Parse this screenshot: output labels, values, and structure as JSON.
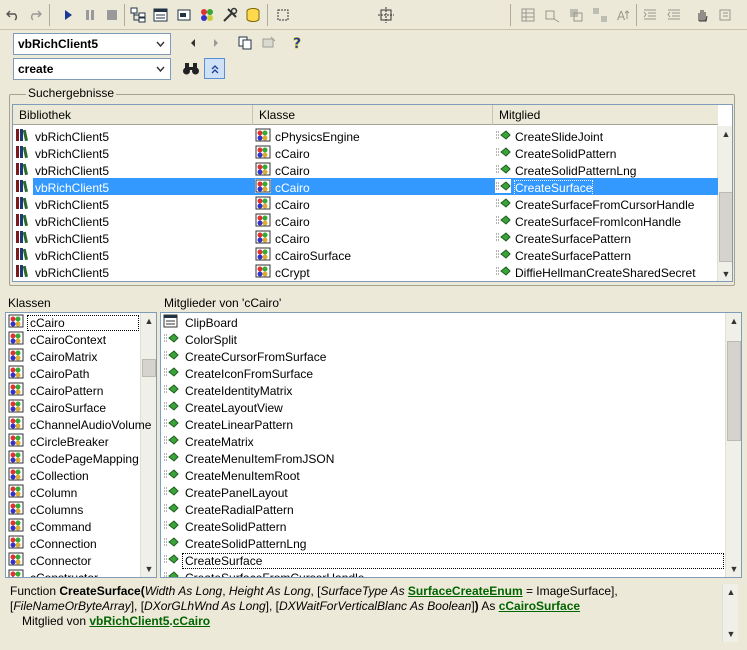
{
  "toolbar": {
    "buttons": [
      {
        "name": "undo-icon"
      },
      {
        "name": "redo-icon"
      },
      {
        "name": "run-icon"
      },
      {
        "name": "pause-icon"
      },
      {
        "name": "stop-icon"
      },
      {
        "name": "project-explorer-icon"
      },
      {
        "name": "properties-icon"
      },
      {
        "name": "form-layout-icon"
      },
      {
        "name": "object-browser-icon"
      },
      {
        "name": "toolbox-icon"
      },
      {
        "name": "database-icon"
      },
      {
        "name": "select-icon"
      },
      {
        "name": "align-icon"
      }
    ]
  },
  "library_combo": {
    "value": "vbRichClient5"
  },
  "search_combo": {
    "value": "create"
  },
  "search_results": {
    "title": "Suchergebnisse",
    "columns": [
      "Bibliothek",
      "Klasse",
      "Mitglied"
    ],
    "rows": [
      {
        "library": "vbRichClient5",
        "class": "cPhysicsEngine",
        "member": "CreateSlideJoint"
      },
      {
        "library": "vbRichClient5",
        "class": "cCairo",
        "member": "CreateSolidPattern"
      },
      {
        "library": "vbRichClient5",
        "class": "cCairo",
        "member": "CreateSolidPatternLng"
      },
      {
        "library": "vbRichClient5",
        "class": "cCairo",
        "member": "CreateSurface",
        "selected": true
      },
      {
        "library": "vbRichClient5",
        "class": "cCairo",
        "member": "CreateSurfaceFromCursorHandle"
      },
      {
        "library": "vbRichClient5",
        "class": "cCairo",
        "member": "CreateSurfaceFromIconHandle"
      },
      {
        "library": "vbRichClient5",
        "class": "cCairo",
        "member": "CreateSurfacePattern"
      },
      {
        "library": "vbRichClient5",
        "class": "cCairoSurface",
        "member": "CreateSurfacePattern"
      },
      {
        "library": "vbRichClient5",
        "class": "cCrypt",
        "member": "DiffieHellmanCreateSharedSecret"
      }
    ]
  },
  "classes_pane": {
    "title": "Klassen",
    "items": [
      "cCairo",
      "cCairoContext",
      "cCairoMatrix",
      "cCairoPath",
      "cCairoPattern",
      "cCairoSurface",
      "cChannelAudioVolume",
      "cCircleBreaker",
      "cCodePageMapping",
      "cCollection",
      "cColumn",
      "cColumns",
      "cCommand",
      "cConnection",
      "cConnector",
      "cConstructor"
    ]
  },
  "members_pane": {
    "title": "Mitglieder von 'cCairo'",
    "items": [
      "ClipBoard",
      "ColorSplit",
      "CreateCursorFromSurface",
      "CreateIconFromSurface",
      "CreateIdentityMatrix",
      "CreateLayoutView",
      "CreateLinearPattern",
      "CreateMatrix",
      "CreateMenuItemFromJSON",
      "CreateMenuItemRoot",
      "CreatePanelLayout",
      "CreateRadialPattern",
      "CreateSolidPattern",
      "CreateSolidPatternLng",
      "CreateSurface",
      "CreateSurfaceFromCursorHandle"
    ]
  },
  "description": {
    "function_kw": "Function ",
    "function_name": "CreateSurface",
    "p1": "Width As Long",
    "p2": "Height As Long",
    "p3a": "SurfaceType As ",
    "p3type": "SurfaceCreateEnum",
    "p3b": " = ImageSurface",
    "p4": "FileNameOrByteArray",
    "p5": "DXorGLhWnd As Long",
    "p6": "DXWaitForVerticalBlanc As Boolean",
    "returns_kw": " As ",
    "return_type": "cCairoSurface",
    "member_of": "Mitglied von ",
    "member_lib": "vbRichClient5",
    "member_class": "cCairo"
  },
  "colors": {
    "selection": "#3399ff",
    "link": "#006400",
    "background": "#ece9d8"
  }
}
